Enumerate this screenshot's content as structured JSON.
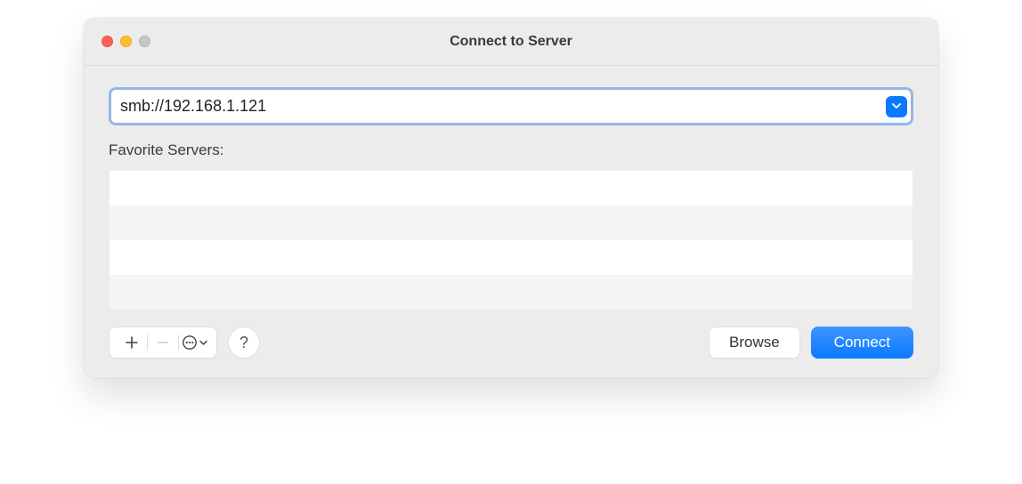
{
  "window": {
    "title": "Connect to Server"
  },
  "address": {
    "value": "smb://192.168.1.121"
  },
  "favorites": {
    "label": "Favorite Servers:",
    "items": []
  },
  "toolbar": {
    "add": "+",
    "remove": "−",
    "help": "?"
  },
  "buttons": {
    "browse": "Browse",
    "connect": "Connect"
  }
}
